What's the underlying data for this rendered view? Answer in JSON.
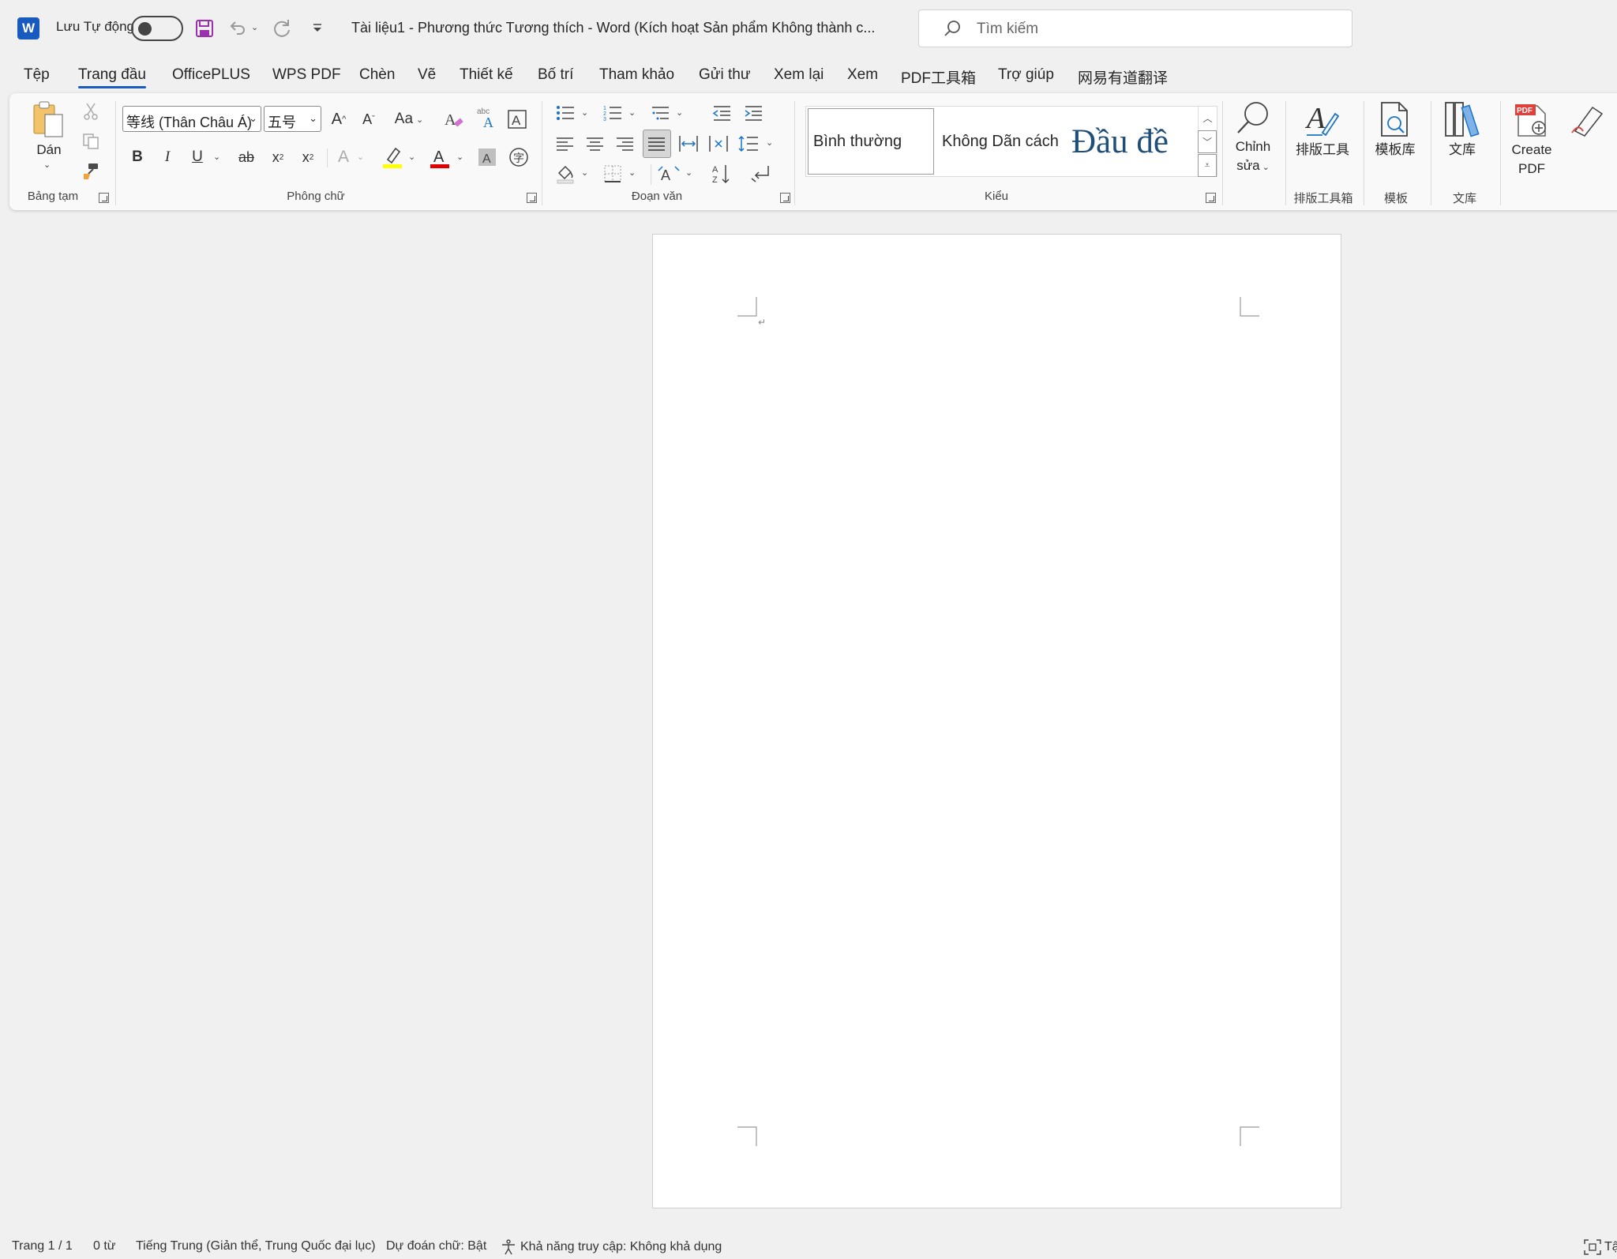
{
  "titlebar": {
    "app_icon": "word-icon",
    "autosave_label": "Lưu Tự động",
    "autosave_state": "off",
    "document_title": "Tài liệu1  -  Phương thức Tương thích  -  Word (Kích hoạt Sản phẩm Không thành c...",
    "search_placeholder": "Tìm kiếm"
  },
  "tabs": [
    {
      "label": "Tệp"
    },
    {
      "label": "Trang đầu",
      "active": true
    },
    {
      "label": "OfficePLUS"
    },
    {
      "label": "WPS PDF"
    },
    {
      "label": "Chèn"
    },
    {
      "label": "Vẽ"
    },
    {
      "label": "Thiết kế"
    },
    {
      "label": "Bố trí"
    },
    {
      "label": "Tham khảo"
    },
    {
      "label": "Gửi thư"
    },
    {
      "label": "Xem lại"
    },
    {
      "label": "Xem"
    },
    {
      "label": "PDF工具箱"
    },
    {
      "label": "Trợ giúp"
    },
    {
      "label": "网易有道翻译"
    }
  ],
  "ribbon": {
    "clipboard": {
      "paste_label": "Dán",
      "group_label": "Bảng tạm"
    },
    "font": {
      "font_name": "等线 (Thân Châu Á)",
      "font_size": "五号",
      "change_case": "Aa",
      "group_label": "Phông chữ"
    },
    "paragraph": {
      "group_label": "Đoạn văn"
    },
    "styles": {
      "items": [
        "Bình thường",
        "Không Dãn cách",
        "Đầu đề"
      ],
      "group_label": "Kiểu"
    },
    "editing": {
      "label_line1": "Chỉnh",
      "label_line2": "sửa"
    },
    "layout_tool": {
      "label": "排版工具",
      "group_label": "排版工具箱"
    },
    "template": {
      "label": "模板库",
      "group_label": "模板"
    },
    "library": {
      "label": "文库",
      "group_label": "文库"
    },
    "create_pdf": {
      "label_line1": "Create",
      "label_line2": "PDF"
    }
  },
  "document": {
    "paragraph_mark": "↵"
  },
  "statusbar": {
    "page": "Trang 1 / 1",
    "words": "0 từ",
    "language": "Tiếng Trung (Giản thể, Trung Quốc đại lục)",
    "prediction": "Dự đoán chữ: Bật",
    "accessibility": "Khả năng truy cập: Không khả dụng",
    "focus_partial": "Tậ"
  },
  "colors": {
    "accent": "#185abd",
    "highlight": "#ffff00",
    "font_color": "#e00000",
    "pdf_red": "#e0403a"
  }
}
